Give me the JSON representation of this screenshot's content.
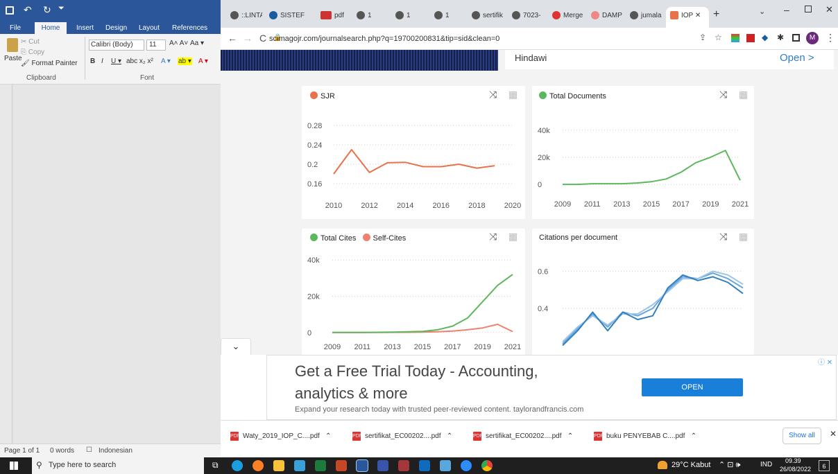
{
  "word": {
    "tabs": [
      "File",
      "Home",
      "Insert",
      "Design",
      "Layout",
      "References"
    ],
    "clipboard": {
      "cut": "Cut",
      "copy": "Copy",
      "paste": "Paste",
      "format_painter": "Format Painter",
      "group": "Clipboard"
    },
    "font": {
      "name": "Calibri (Body)",
      "size": "11",
      "group": "Font"
    },
    "status": {
      "page": "Page 1 of 1",
      "words": "0 words",
      "language": "Indonesian"
    }
  },
  "browser": {
    "tabs": [
      "::LINTA",
      "SISTEF",
      "pdf",
      "1",
      "1",
      "1",
      "sertifik",
      "7023-",
      "Merge",
      "DAMP",
      "jumala",
      "IOP"
    ],
    "url": "scimagojr.com/journalsearch.php?q=19700200831&tip=sid&clean=0",
    "publisher": "Hindawi",
    "open_link": "Open >"
  },
  "ad": {
    "headline_line1": "Get a Free Trial Today - Accounting,",
    "headline_line2": "analytics & more",
    "sub": "Expand your research today with trusted peer-reviewed content. taylorandfrancis.com",
    "button": "OPEN",
    "badge": "ⓘ ✕"
  },
  "downloads": {
    "items": [
      "Waty_2019_IOP_C....pdf",
      "sertifikat_EC00202....pdf",
      "sertifikat_EC00202....pdf",
      "buku PENYEBAB C....pdf"
    ],
    "show_all": "Show all"
  },
  "taskbar": {
    "search_placeholder": "Type here to search",
    "weather": "29°C Kabut",
    "lang": "IND",
    "time": "09.39",
    "date": "26/08/2022",
    "notif": "6"
  },
  "colors": {
    "sjr": "#e8734a",
    "green": "#5cb85c",
    "selfcites": "#f08070",
    "blue_dark": "#2f7fc1",
    "blue_light": "#9cc4e8"
  },
  "chart_data": [
    {
      "type": "line",
      "title": "SJR",
      "series": [
        {
          "name": "SJR",
          "color": "#e8734a",
          "x": [
            2010,
            2011,
            2012,
            2013,
            2014,
            2015,
            2016,
            2017,
            2018,
            2019
          ],
          "y": [
            0.18,
            0.23,
            0.183,
            0.203,
            0.204,
            0.195,
            0.195,
            0.2,
            0.192,
            0.197
          ]
        }
      ],
      "xticks": [
        "2010",
        "2012",
        "2014",
        "2016",
        "2018",
        "2020"
      ],
      "yticks": [
        "0.28",
        "0.24",
        "0.2",
        "0.16"
      ],
      "xlim": [
        2010,
        2020
      ],
      "ylim": [
        0.15,
        0.29
      ]
    },
    {
      "type": "line",
      "title": "Total Documents",
      "series": [
        {
          "name": "Total Documents",
          "color": "#5cb85c",
          "x": [
            2009,
            2010,
            2011,
            2012,
            2013,
            2014,
            2015,
            2016,
            2017,
            2018,
            2019,
            2020,
            2021
          ],
          "y": [
            0,
            0,
            500,
            500,
            500,
            1000,
            2000,
            4000,
            9000,
            16000,
            20000,
            25000,
            3000
          ]
        }
      ],
      "xticks": [
        "2009",
        "2011",
        "2013",
        "2015",
        "2017",
        "2019",
        "2021"
      ],
      "yticks": [
        "40k",
        "20k",
        "0"
      ],
      "xlim": [
        2009,
        2021
      ],
      "ylim": [
        -2000,
        46000
      ]
    },
    {
      "type": "line",
      "title": "",
      "series": [
        {
          "name": "Total Cites",
          "color": "#5cb85c",
          "x": [
            2009,
            2010,
            2011,
            2012,
            2013,
            2014,
            2015,
            2016,
            2017,
            2018,
            2019,
            2020,
            2021
          ],
          "y": [
            0,
            0,
            0,
            100,
            200,
            400,
            600,
            1500,
            3500,
            8000,
            17000,
            26000,
            32000
          ]
        },
        {
          "name": "Self-Cites",
          "color": "#f08070",
          "x": [
            2009,
            2010,
            2011,
            2012,
            2013,
            2014,
            2015,
            2016,
            2017,
            2018,
            2019,
            2020,
            2021
          ],
          "y": [
            0,
            0,
            0,
            0,
            50,
            100,
            200,
            400,
            800,
            1500,
            2500,
            4500,
            500
          ]
        }
      ],
      "xticks": [
        "2009",
        "2011",
        "2013",
        "2015",
        "2017",
        "2019",
        "2021"
      ],
      "yticks": [
        "40k",
        "20k",
        "0"
      ],
      "xlim": [
        2009,
        2021
      ],
      "ylim": [
        -2000,
        42000
      ]
    },
    {
      "type": "line",
      "title": "Citations per document",
      "series": [
        {
          "name": "dark",
          "color": "#2f7fc1",
          "x": [
            2009,
            2010,
            2011,
            2012,
            2013,
            2014,
            2015,
            2016,
            2017,
            2018,
            2019,
            2020,
            2021
          ],
          "y": [
            0.2,
            0.28,
            0.38,
            0.28,
            0.38,
            0.34,
            0.36,
            0.51,
            0.58,
            0.55,
            0.57,
            0.54,
            0.48
          ]
        },
        {
          "name": "light",
          "color": "#9cc4e8",
          "x": [
            2009,
            2010,
            2011,
            2012,
            2013,
            2014,
            2015,
            2016,
            2017,
            2018,
            2019,
            2020,
            2021
          ],
          "y": [
            0.22,
            0.3,
            0.36,
            0.31,
            0.37,
            0.37,
            0.42,
            0.49,
            0.56,
            0.56,
            0.6,
            0.58,
            0.53
          ]
        },
        {
          "name": "light2",
          "color": "#6aa6da",
          "x": [
            2009,
            2010,
            2011,
            2012,
            2013,
            2014,
            2015,
            2016,
            2017,
            2018,
            2019,
            2020,
            2021
          ],
          "y": [
            0.21,
            0.29,
            0.37,
            0.3,
            0.38,
            0.36,
            0.4,
            0.5,
            0.57,
            0.56,
            0.59,
            0.56,
            0.51
          ]
        }
      ],
      "xticks": [],
      "yticks": [
        "0.6",
        "0.4"
      ],
      "xlim": [
        2009,
        2021
      ],
      "ylim": [
        0.15,
        0.65
      ]
    }
  ]
}
